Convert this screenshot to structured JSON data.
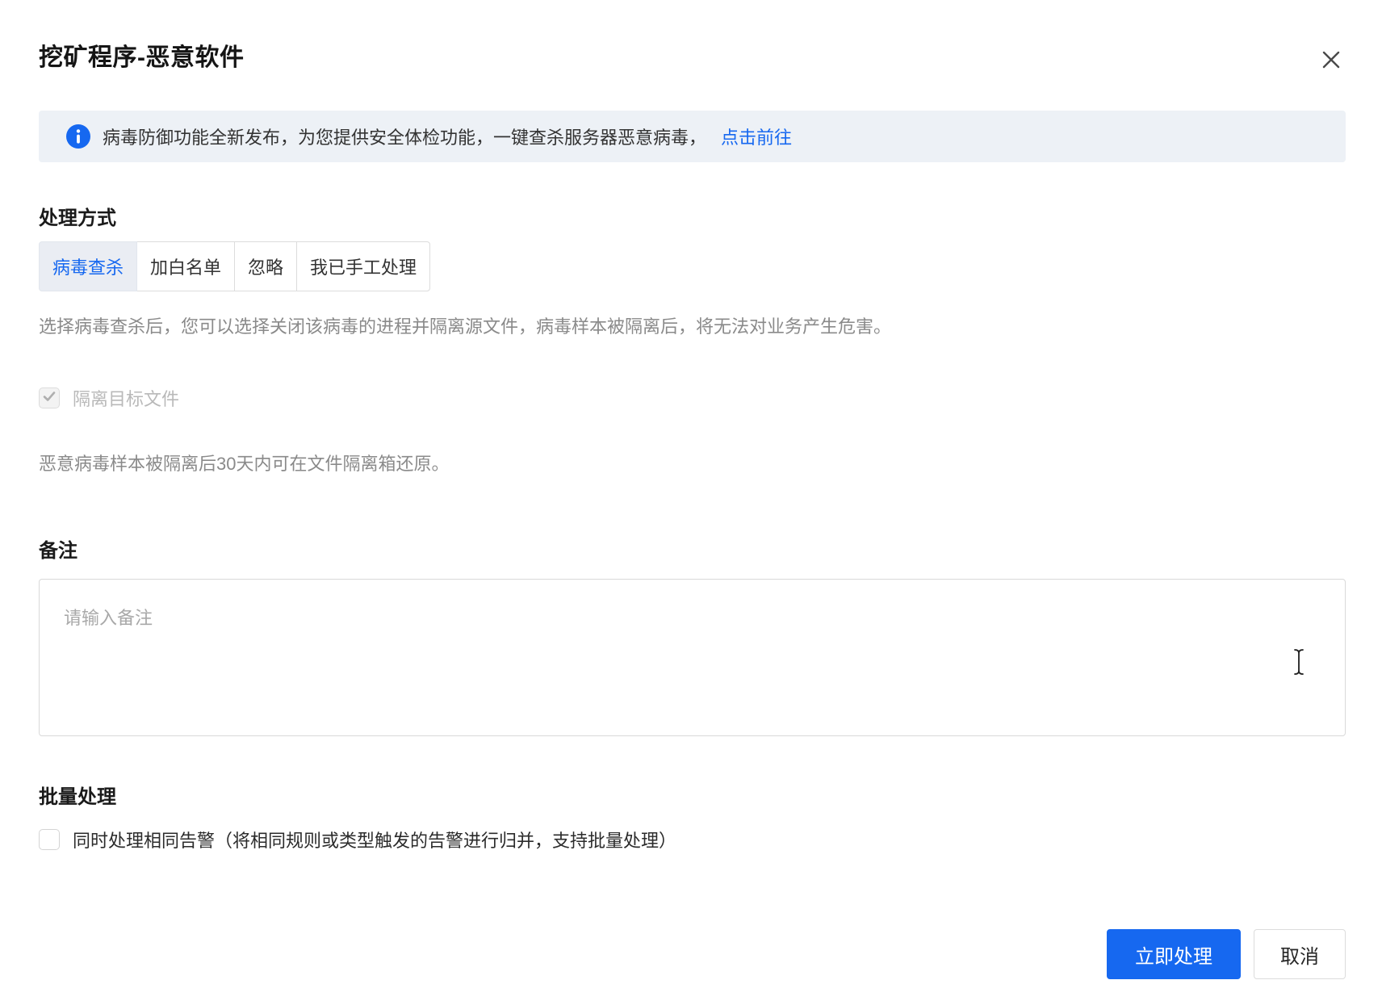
{
  "dialog": {
    "title": "挖矿程序-恶意软件"
  },
  "banner": {
    "text": "病毒防御功能全新发布，为您提供安全体检功能，一键查杀服务器恶意病毒，",
    "link": "点击前往"
  },
  "handling": {
    "label": "处理方式",
    "options": [
      {
        "label": "病毒查杀",
        "selected": true
      },
      {
        "label": "加白名单",
        "selected": false
      },
      {
        "label": "忽略",
        "selected": false
      },
      {
        "label": "我已手工处理",
        "selected": false
      }
    ],
    "description": "选择病毒查杀后，您可以选择关闭该病毒的进程并隔离源文件，病毒样本被隔离后，将无法对业务产生危害。",
    "quarantine_checkbox": {
      "label": "隔离目标文件",
      "checked": true,
      "disabled": true
    },
    "quarantine_note": "恶意病毒样本被隔离后30天内可在文件隔离箱还原。"
  },
  "remark": {
    "label": "备注",
    "placeholder": "请输入备注",
    "value": ""
  },
  "batch": {
    "label": "批量处理",
    "checkbox_label": "同时处理相同告警（将相同规则或类型触发的告警进行归并，支持批量处理）",
    "checked": false
  },
  "footer": {
    "confirm_label": "立即处理",
    "cancel_label": "取消"
  },
  "icons": {
    "info": "info-icon",
    "close": "close-icon",
    "check": "check-icon",
    "mouse_cursor": "ibeam-cursor"
  },
  "colors": {
    "accent": "#1668F0",
    "banner_bg": "#EDF1F6",
    "active_tab_bg": "#EAEDF3"
  }
}
